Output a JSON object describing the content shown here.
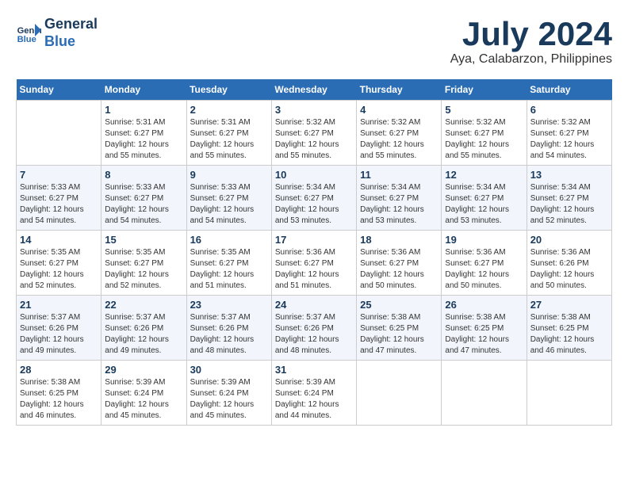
{
  "header": {
    "logo_line1": "General",
    "logo_line2": "Blue",
    "month_year": "July 2024",
    "location": "Aya, Calabarzon, Philippines"
  },
  "days_of_week": [
    "Sunday",
    "Monday",
    "Tuesday",
    "Wednesday",
    "Thursday",
    "Friday",
    "Saturday"
  ],
  "weeks": [
    [
      {
        "day": "",
        "sunrise": "",
        "sunset": "",
        "daylight": ""
      },
      {
        "day": "1",
        "sunrise": "Sunrise: 5:31 AM",
        "sunset": "Sunset: 6:27 PM",
        "daylight": "Daylight: 12 hours and 55 minutes."
      },
      {
        "day": "2",
        "sunrise": "Sunrise: 5:31 AM",
        "sunset": "Sunset: 6:27 PM",
        "daylight": "Daylight: 12 hours and 55 minutes."
      },
      {
        "day": "3",
        "sunrise": "Sunrise: 5:32 AM",
        "sunset": "Sunset: 6:27 PM",
        "daylight": "Daylight: 12 hours and 55 minutes."
      },
      {
        "day": "4",
        "sunrise": "Sunrise: 5:32 AM",
        "sunset": "Sunset: 6:27 PM",
        "daylight": "Daylight: 12 hours and 55 minutes."
      },
      {
        "day": "5",
        "sunrise": "Sunrise: 5:32 AM",
        "sunset": "Sunset: 6:27 PM",
        "daylight": "Daylight: 12 hours and 55 minutes."
      },
      {
        "day": "6",
        "sunrise": "Sunrise: 5:32 AM",
        "sunset": "Sunset: 6:27 PM",
        "daylight": "Daylight: 12 hours and 54 minutes."
      }
    ],
    [
      {
        "day": "7",
        "sunrise": "Sunrise: 5:33 AM",
        "sunset": "Sunset: 6:27 PM",
        "daylight": "Daylight: 12 hours and 54 minutes."
      },
      {
        "day": "8",
        "sunrise": "Sunrise: 5:33 AM",
        "sunset": "Sunset: 6:27 PM",
        "daylight": "Daylight: 12 hours and 54 minutes."
      },
      {
        "day": "9",
        "sunrise": "Sunrise: 5:33 AM",
        "sunset": "Sunset: 6:27 PM",
        "daylight": "Daylight: 12 hours and 54 minutes."
      },
      {
        "day": "10",
        "sunrise": "Sunrise: 5:34 AM",
        "sunset": "Sunset: 6:27 PM",
        "daylight": "Daylight: 12 hours and 53 minutes."
      },
      {
        "day": "11",
        "sunrise": "Sunrise: 5:34 AM",
        "sunset": "Sunset: 6:27 PM",
        "daylight": "Daylight: 12 hours and 53 minutes."
      },
      {
        "day": "12",
        "sunrise": "Sunrise: 5:34 AM",
        "sunset": "Sunset: 6:27 PM",
        "daylight": "Daylight: 12 hours and 53 minutes."
      },
      {
        "day": "13",
        "sunrise": "Sunrise: 5:34 AM",
        "sunset": "Sunset: 6:27 PM",
        "daylight": "Daylight: 12 hours and 52 minutes."
      }
    ],
    [
      {
        "day": "14",
        "sunrise": "Sunrise: 5:35 AM",
        "sunset": "Sunset: 6:27 PM",
        "daylight": "Daylight: 12 hours and 52 minutes."
      },
      {
        "day": "15",
        "sunrise": "Sunrise: 5:35 AM",
        "sunset": "Sunset: 6:27 PM",
        "daylight": "Daylight: 12 hours and 52 minutes."
      },
      {
        "day": "16",
        "sunrise": "Sunrise: 5:35 AM",
        "sunset": "Sunset: 6:27 PM",
        "daylight": "Daylight: 12 hours and 51 minutes."
      },
      {
        "day": "17",
        "sunrise": "Sunrise: 5:36 AM",
        "sunset": "Sunset: 6:27 PM",
        "daylight": "Daylight: 12 hours and 51 minutes."
      },
      {
        "day": "18",
        "sunrise": "Sunrise: 5:36 AM",
        "sunset": "Sunset: 6:27 PM",
        "daylight": "Daylight: 12 hours and 50 minutes."
      },
      {
        "day": "19",
        "sunrise": "Sunrise: 5:36 AM",
        "sunset": "Sunset: 6:27 PM",
        "daylight": "Daylight: 12 hours and 50 minutes."
      },
      {
        "day": "20",
        "sunrise": "Sunrise: 5:36 AM",
        "sunset": "Sunset: 6:26 PM",
        "daylight": "Daylight: 12 hours and 50 minutes."
      }
    ],
    [
      {
        "day": "21",
        "sunrise": "Sunrise: 5:37 AM",
        "sunset": "Sunset: 6:26 PM",
        "daylight": "Daylight: 12 hours and 49 minutes."
      },
      {
        "day": "22",
        "sunrise": "Sunrise: 5:37 AM",
        "sunset": "Sunset: 6:26 PM",
        "daylight": "Daylight: 12 hours and 49 minutes."
      },
      {
        "day": "23",
        "sunrise": "Sunrise: 5:37 AM",
        "sunset": "Sunset: 6:26 PM",
        "daylight": "Daylight: 12 hours and 48 minutes."
      },
      {
        "day": "24",
        "sunrise": "Sunrise: 5:37 AM",
        "sunset": "Sunset: 6:26 PM",
        "daylight": "Daylight: 12 hours and 48 minutes."
      },
      {
        "day": "25",
        "sunrise": "Sunrise: 5:38 AM",
        "sunset": "Sunset: 6:25 PM",
        "daylight": "Daylight: 12 hours and 47 minutes."
      },
      {
        "day": "26",
        "sunrise": "Sunrise: 5:38 AM",
        "sunset": "Sunset: 6:25 PM",
        "daylight": "Daylight: 12 hours and 47 minutes."
      },
      {
        "day": "27",
        "sunrise": "Sunrise: 5:38 AM",
        "sunset": "Sunset: 6:25 PM",
        "daylight": "Daylight: 12 hours and 46 minutes."
      }
    ],
    [
      {
        "day": "28",
        "sunrise": "Sunrise: 5:38 AM",
        "sunset": "Sunset: 6:25 PM",
        "daylight": "Daylight: 12 hours and 46 minutes."
      },
      {
        "day": "29",
        "sunrise": "Sunrise: 5:39 AM",
        "sunset": "Sunset: 6:24 PM",
        "daylight": "Daylight: 12 hours and 45 minutes."
      },
      {
        "day": "30",
        "sunrise": "Sunrise: 5:39 AM",
        "sunset": "Sunset: 6:24 PM",
        "daylight": "Daylight: 12 hours and 45 minutes."
      },
      {
        "day": "31",
        "sunrise": "Sunrise: 5:39 AM",
        "sunset": "Sunset: 6:24 PM",
        "daylight": "Daylight: 12 hours and 44 minutes."
      },
      {
        "day": "",
        "sunrise": "",
        "sunset": "",
        "daylight": ""
      },
      {
        "day": "",
        "sunrise": "",
        "sunset": "",
        "daylight": ""
      },
      {
        "day": "",
        "sunrise": "",
        "sunset": "",
        "daylight": ""
      }
    ]
  ]
}
